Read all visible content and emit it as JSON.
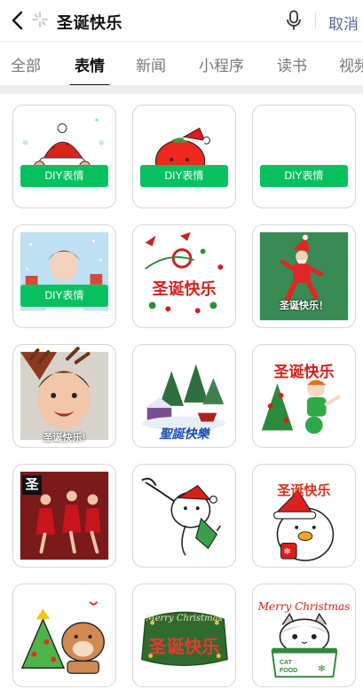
{
  "search": {
    "query": "圣诞快乐",
    "cancel_label": "取消"
  },
  "tabs": [
    {
      "label": "全部",
      "active": false
    },
    {
      "label": "表情",
      "active": true
    },
    {
      "label": "新闻",
      "active": false
    },
    {
      "label": "小程序",
      "active": false
    },
    {
      "label": "读书",
      "active": false
    },
    {
      "label": "视频",
      "active": false
    }
  ],
  "diy_label": "DIY表情",
  "stickers": {
    "greeting_cn": "圣诞快乐！",
    "greeting_cn_plain": "圣诞快乐",
    "greeting_cn_exclaim_half": "圣诞快乐!",
    "greeting_trad": "聖誕快樂",
    "merry_christmas": "Merry Christmas",
    "cat_food": "CAT FOOD",
    "sheng_char": "圣"
  },
  "colors": {
    "accent_green": "#07c160",
    "cancel_blue": "#576b95",
    "brand_red": "#d91e18"
  }
}
